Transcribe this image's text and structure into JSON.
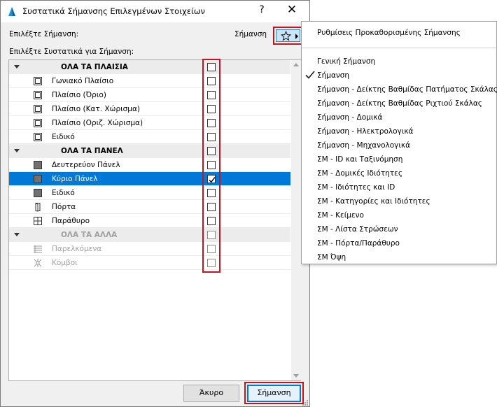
{
  "dialog": {
    "title": "Συστατικά Σήμανσης Επιλεγμένων Στοιχείων",
    "help_label": "?",
    "close_label": "✕",
    "select_marker_label": "Επιλέξτε Σήμανση:",
    "current_marker": "Σήμανση",
    "components_label": "Επιλέξτε Συστατικά για Σήμανση:",
    "cancel_label": "Άκυρο",
    "ok_label": "Σήμανση"
  },
  "list": {
    "rows": [
      {
        "type": "group",
        "label": "ΟΛΑ ΤΑ ΠΛΑΙΣΙΑ",
        "checked": false
      },
      {
        "type": "item",
        "label": "Γωνιακό Πλαίσιο",
        "icon": "frame-icon",
        "checked": false
      },
      {
        "type": "item",
        "label": "Πλαίσιο (Όριο)",
        "icon": "frame-icon",
        "checked": false
      },
      {
        "type": "item",
        "label": "Πλαίσιο (Κατ. Χώρισμα)",
        "icon": "frame-icon",
        "checked": false
      },
      {
        "type": "item",
        "label": "Πλαίσιο (Οριζ. Χώρισμα)",
        "icon": "frame-icon",
        "checked": false
      },
      {
        "type": "item",
        "label": "Ειδικό",
        "icon": "frame-icon",
        "checked": false
      },
      {
        "type": "group",
        "label": "ΟΛΑ ΤΑ ΠΑΝΕΛ",
        "checked": false
      },
      {
        "type": "item",
        "label": "Δευτερεύον Πάνελ",
        "icon": "panel-icon",
        "checked": false
      },
      {
        "type": "item",
        "label": "Κύριο Πάνελ",
        "icon": "panel-icon",
        "checked": true,
        "selected": true
      },
      {
        "type": "item",
        "label": "Ειδικό",
        "icon": "panel-icon",
        "checked": false
      },
      {
        "type": "item",
        "label": "Πόρτα",
        "icon": "door-icon",
        "checked": false
      },
      {
        "type": "item",
        "label": "Παράθυρο",
        "icon": "window-icon",
        "checked": false
      },
      {
        "type": "group",
        "label": "ΟΛΑ ΤΑ ΑΛΛΑ",
        "checked": false,
        "disabled": true
      },
      {
        "type": "item",
        "label": "Παρελκόμενα",
        "icon": "accessory-icon",
        "checked": false,
        "disabled": true
      },
      {
        "type": "item",
        "label": "Κόμβοι",
        "icon": "junction-icon",
        "checked": false,
        "disabled": true
      }
    ]
  },
  "menu": {
    "default_settings": "Ρυθμίσεις Προκαθορισμένης Σήμανσης",
    "items": [
      "Γενική Σήμανση",
      "Σήμανση",
      "Σήμανση - Δείκτης Βαθμίδας Πατήματος Σκάλας",
      "Σήμανση - Δείκτης Βαθμίδας Ριχτιού Σκάλας",
      "Σήμανση - Δομικά",
      "Σήμανση - Ηλεκτρολογικά",
      "Σήμανση - Μηχανολογικά",
      "ΣΜ - ID και Ταξινόμηση",
      "ΣΜ - Δομικές Ιδιότητες",
      "ΣΜ - Ιδιότητες και ID",
      "ΣΜ - Κατηγορίες και Ιδιότητες",
      "ΣΜ - Κείμενο",
      "ΣΜ - Λίστα Στρώσεων",
      "ΣΜ - Πόρτα/Παράθυρο",
      "ΣΜ Όψη"
    ],
    "checked_index": 1
  }
}
